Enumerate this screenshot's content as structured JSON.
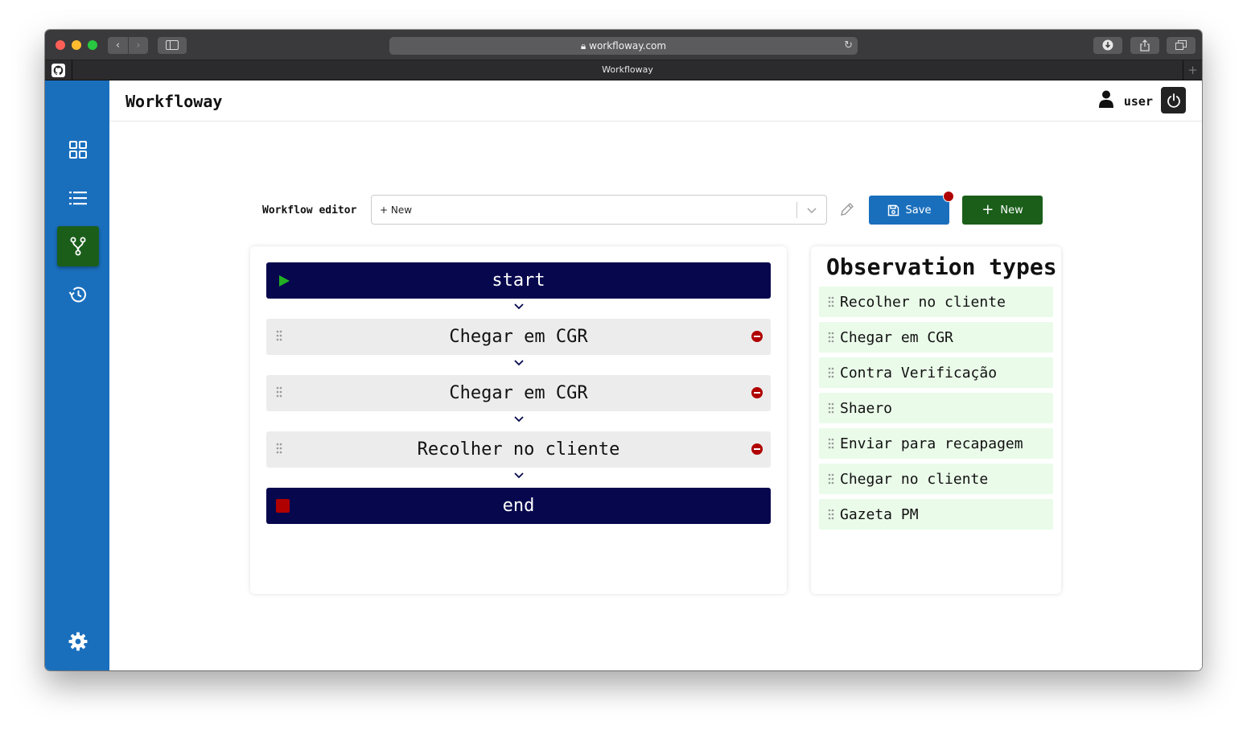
{
  "browser": {
    "url": "workfloway.com",
    "tab_title": "Workfloway",
    "tab_plus": "+"
  },
  "header": {
    "brand": "Workfloway",
    "username": "user"
  },
  "sidebar": {
    "items": [
      {
        "name": "dashboard",
        "icon": "grid-icon"
      },
      {
        "name": "list",
        "icon": "list-icon"
      },
      {
        "name": "workflows",
        "icon": "branch-icon",
        "active": true
      },
      {
        "name": "history",
        "icon": "history-icon"
      }
    ],
    "settings_icon": "gear-icon"
  },
  "editor": {
    "label": "Workflow editor",
    "select_value": "+ New",
    "save_label": "Save",
    "new_label": "New"
  },
  "steps": {
    "start": "start",
    "items": [
      "Chegar em CGR",
      "Chegar em CGR",
      "Recolher no cliente"
    ],
    "end": "end"
  },
  "observations": {
    "title": "Observation types",
    "items": [
      "Recolher no cliente",
      "Chegar em CGR",
      "Contra Verificação",
      "Shaero",
      "Enviar para recapagem",
      "Chegar no cliente",
      "Gazeta PM"
    ]
  },
  "colors": {
    "sidebar": "#1a6fbd",
    "active": "#1a5e1a",
    "terminal_step": "#07074e",
    "danger": "#b00000",
    "obs_item": "#eafbea"
  }
}
